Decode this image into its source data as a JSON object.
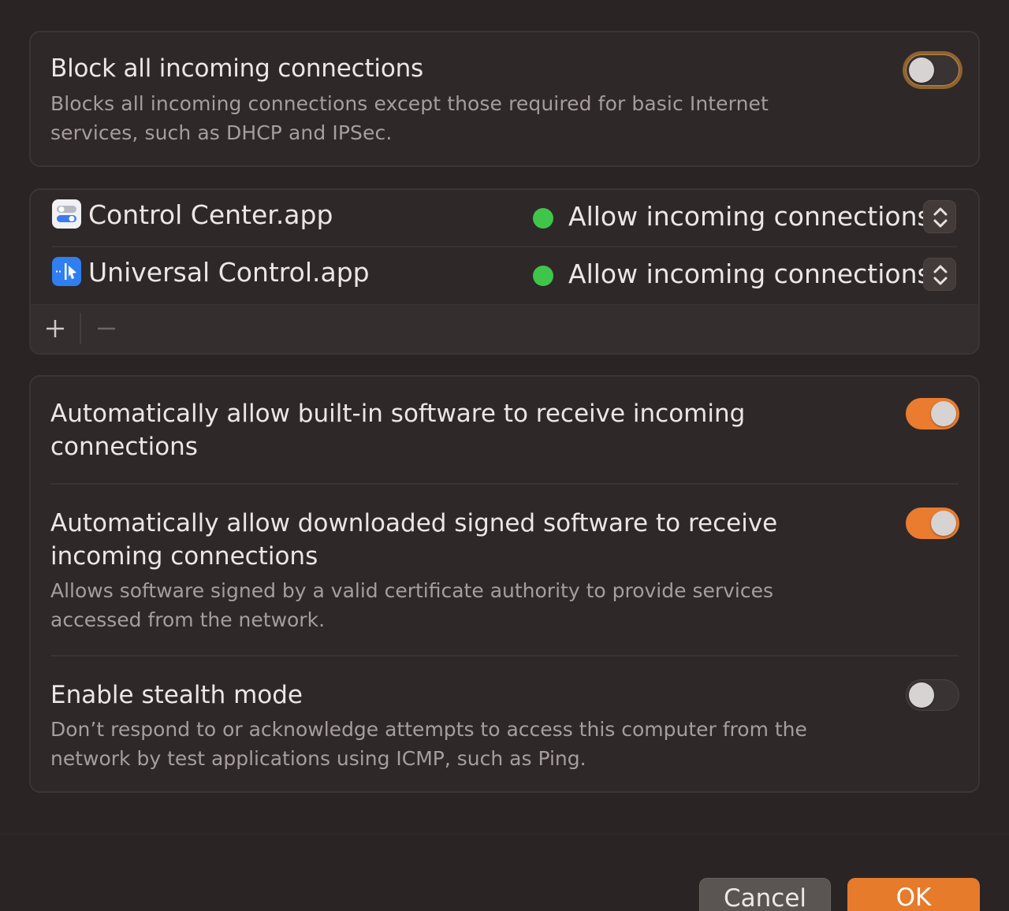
{
  "block_all": {
    "title": "Block all incoming connections",
    "description_line1": "Blocks all incoming connections except those required for basic Internet",
    "description_line2": "services, such as DHCP and IPSec.",
    "enabled": false
  },
  "apps": [
    {
      "name": "Control Center.app",
      "icon": "control-center-icon",
      "status_color": "#3fc54a",
      "policy": "Allow incoming connections"
    },
    {
      "name": "Universal Control.app",
      "icon": "universal-control-icon",
      "status_color": "#3fc54a",
      "policy": "Allow incoming connections"
    }
  ],
  "apps_footer": {
    "add_symbol": "+",
    "remove_symbol": "−"
  },
  "settings": [
    {
      "title_line1": "Automatically allow built-in software to receive incoming",
      "title_line2": "connections",
      "enabled": true
    },
    {
      "title_line1": "Automatically allow downloaded signed software to receive",
      "title_line2": "incoming connections",
      "description_line1": "Allows software signed by a valid certificate authority to provide services",
      "description_line2": "accessed from the network.",
      "enabled": true
    },
    {
      "title_line1": "Enable stealth mode",
      "description_line1": "Don’t respond to or acknowledge attempts to access this computer from the",
      "description_line2": "network by test applications using ICMP, such as Ping.",
      "enabled": false
    }
  ],
  "buttons": {
    "cancel": "Cancel",
    "ok": "OK"
  },
  "colors": {
    "accent": "#e97c2f",
    "background": "#2b2424",
    "status_green": "#3fc54a"
  }
}
